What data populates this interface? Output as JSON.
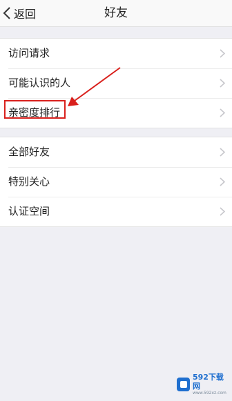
{
  "header": {
    "back_label": "返回",
    "title": "好友"
  },
  "group1": {
    "items": [
      {
        "label": "访问请求"
      },
      {
        "label": "可能认识的人"
      },
      {
        "label": "亲密度排行"
      }
    ]
  },
  "group2": {
    "items": [
      {
        "label": "全部好友"
      },
      {
        "label": "特别关心"
      },
      {
        "label": "认证空间"
      }
    ]
  },
  "annotation": {
    "color": "#d9201c",
    "highlighted_item": "亲密度排行"
  },
  "watermark": {
    "brand": "592下载网",
    "url": "www.592xz.com"
  },
  "colors": {
    "background": "#efeff4",
    "row_background": "#ffffff",
    "chevron": "#c7c7cc"
  }
}
